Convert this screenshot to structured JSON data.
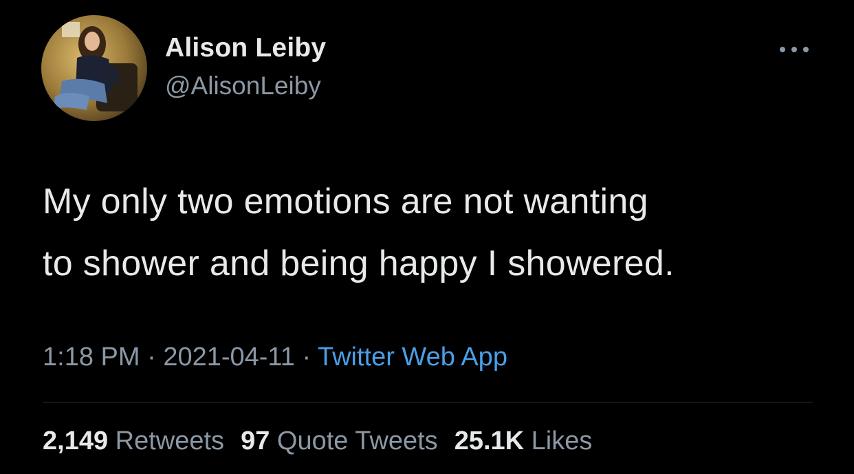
{
  "author": {
    "display_name": "Alison Leiby",
    "handle": "@AlisonLeiby",
    "avatar": "profile-photo"
  },
  "menu_icon": "more-dots-icon",
  "tweet": {
    "text_line_1": "My only two emotions are not wanting",
    "text_line_2": "to shower and being happy I showered."
  },
  "meta": {
    "time": "1:18 PM",
    "separator": "·",
    "date": "2021-04-11",
    "source": "Twitter Web App"
  },
  "stats": {
    "retweets_count": "2,149",
    "retweets_label": "Retweets",
    "quotes_count": "97",
    "quotes_label": "Quote Tweets",
    "likes_count": "25.1K",
    "likes_label": "Likes"
  },
  "colors": {
    "background": "#000000",
    "primary_text": "#e7e9ea",
    "secondary_text": "#8b98a5",
    "link": "#4a9fe8",
    "divider": "#2f3336"
  }
}
